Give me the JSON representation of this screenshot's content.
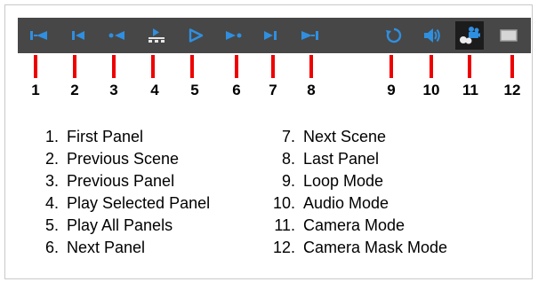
{
  "toolbar": {
    "buttons": [
      {
        "number": "1",
        "label": "First Panel",
        "icon": "first-panel-icon"
      },
      {
        "number": "2",
        "label": "Previous Scene",
        "icon": "previous-scene-icon"
      },
      {
        "number": "3",
        "label": "Previous Panel",
        "icon": "previous-panel-icon"
      },
      {
        "number": "4",
        "label": "Play Selected Panel",
        "icon": "play-selected-panel-icon"
      },
      {
        "number": "5",
        "label": "Play All Panels",
        "icon": "play-all-panels-icon"
      },
      {
        "number": "6",
        "label": "Next Panel",
        "icon": "next-panel-icon"
      },
      {
        "number": "7",
        "label": "Next Scene",
        "icon": "next-scene-icon"
      },
      {
        "number": "8",
        "label": "Last Panel",
        "icon": "last-panel-icon"
      },
      {
        "number": "9",
        "label": "Loop Mode",
        "icon": "loop-icon"
      },
      {
        "number": "10",
        "label": "Audio Mode",
        "icon": "speaker-icon"
      },
      {
        "number": "11",
        "label": "Camera Mode",
        "icon": "camera-icon",
        "active": true
      },
      {
        "number": "12",
        "label": "Camera Mask Mode",
        "icon": "camera-mask-icon"
      }
    ]
  },
  "legend": {
    "items": [
      {
        "n": "1.",
        "text": "First Panel"
      },
      {
        "n": "2.",
        "text": "Previous Scene"
      },
      {
        "n": "3.",
        "text": "Previous Panel"
      },
      {
        "n": "4.",
        "text": "Play Selected Panel"
      },
      {
        "n": "5.",
        "text": "Play All Panels"
      },
      {
        "n": "6.",
        "text": "Next Panel"
      },
      {
        "n": "7.",
        "text": "Next Scene"
      },
      {
        "n": "8.",
        "text": "Last Panel"
      },
      {
        "n": "9.",
        "text": "Loop Mode"
      },
      {
        "n": "10.",
        "text": "Audio Mode"
      },
      {
        "n": "11.",
        "text": "Camera Mode"
      },
      {
        "n": "12.",
        "text": "Camera Mask Mode"
      }
    ]
  },
  "colors": {
    "toolbar_bg": "#474747",
    "icon_blue": "#2f8fe0",
    "marker_red": "#ee0000",
    "active_bg": "#1c1c1c"
  }
}
